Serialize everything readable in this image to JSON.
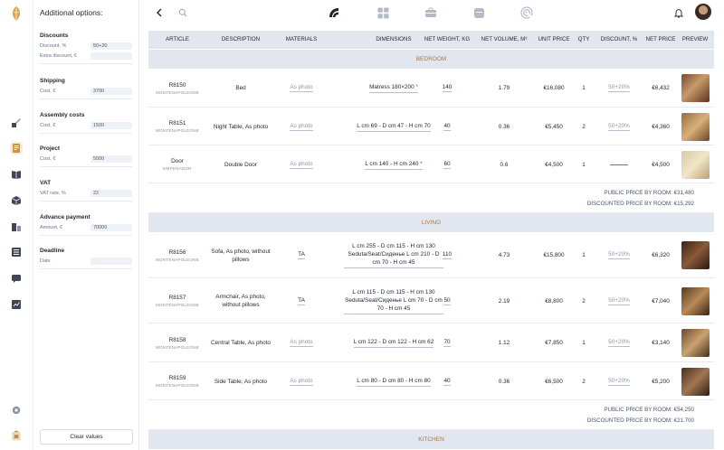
{
  "sidebar": {
    "icons": [
      "brush-icon",
      "document-icon",
      "book-icon",
      "box-icon",
      "building-icon",
      "list-icon",
      "chat-icon",
      "chart-icon",
      "gear-icon",
      "catalog-icon"
    ]
  },
  "options": {
    "title": "Additional options:",
    "sections": [
      {
        "title": "Discounts",
        "rows": [
          {
            "label": "Discount, %",
            "value": "50+20"
          },
          {
            "label": "Extra discount, €",
            "value": ""
          }
        ]
      },
      {
        "title": "Shipping",
        "rows": [
          {
            "label": "Cost, €",
            "value": "3700"
          }
        ]
      },
      {
        "title": "Assembly costs",
        "rows": [
          {
            "label": "Cost, €",
            "value": "1500"
          }
        ]
      },
      {
        "title": "Project",
        "rows": [
          {
            "label": "Cost, €",
            "value": "5000"
          }
        ]
      },
      {
        "title": "VAT",
        "rows": [
          {
            "label": "VAT rate, %",
            "value": "22"
          }
        ]
      },
      {
        "title": "Advance payment",
        "rows": [
          {
            "label": "Amount, €",
            "value": "70000"
          }
        ]
      },
      {
        "title": "Deadline",
        "rows": [
          {
            "label": "Date",
            "value": ""
          }
        ]
      }
    ],
    "clear_label": "Clear values"
  },
  "colors": {
    "accent": "#a6784b",
    "header_bg": "#e1e6ef",
    "required": "#d23b3b"
  },
  "table": {
    "headers": [
      "ARTICLE",
      "DESCRIPTION",
      "MATERIALS",
      "DIMENSIONS",
      "NET WEIGHT, KG",
      "NET VOLUME, M³",
      "UNIT PRICE",
      "QTY",
      "DISCOUNT, %",
      "NET PRICE",
      "PREVIEW"
    ],
    "groups": [
      {
        "name": "BEDROOM",
        "rows": [
          {
            "article": "R8150",
            "brand": "MONTENAPOLEONE",
            "description": "Bed",
            "materials": "As photo",
            "materials_muted": true,
            "dimensions": "Matress 180×200",
            "dim_star": true,
            "weight": "140",
            "volume": "1.79",
            "unit_price": "€16,080",
            "qty": "1",
            "discount": "50+20%",
            "net_price": "€6,432"
          },
          {
            "article": "R8151",
            "brand": "MONTENAPOLEONE",
            "description": "Night Table, As photo",
            "materials": "As photo",
            "materials_muted": true,
            "dimensions": "L cm 69 - D cm 47 - H cm 70",
            "dim_star": false,
            "weight": "40",
            "volume": "0.36",
            "unit_price": "€5,450",
            "qty": "2",
            "discount": "50+20%",
            "net_price": "€4,360"
          },
          {
            "article": "Door",
            "brand": "EMPENADOR",
            "description": "Double Door",
            "materials": "As photo",
            "materials_muted": true,
            "dimensions": "L cm 140 - H cm 240",
            "dim_star": true,
            "weight": "60",
            "volume": "0.6",
            "unit_price": "€4,500",
            "qty": "1",
            "discount": "",
            "net_price": "€4,500"
          }
        ],
        "public_price": "PUBLIC PRICE BY ROOM: €31,480",
        "discounted_price": "DISCOUNTED PRICE BY ROOM: €15,292"
      },
      {
        "name": "LIVING",
        "rows": [
          {
            "article": "R8156",
            "brand": "MONTENAPOLEONE",
            "description": "Sofa, As photo, without pillows",
            "materials": "TA",
            "materials_muted": false,
            "dimensions": "L cm 255 - D cm 115 - H cm 130 Seduta/Seat/Сиденье L cm 210 - D cm 70 - H cm 45",
            "dim_star": false,
            "weight": "110",
            "volume": "4.73",
            "unit_price": "€15,800",
            "qty": "1",
            "discount": "50+20%",
            "net_price": "€6,320"
          },
          {
            "article": "R8157",
            "brand": "MONTENAPOLEONE",
            "description": "Armchair, As photo, without pillows",
            "materials": "TA",
            "materials_muted": false,
            "dimensions": "L cm 115 - D cm 115 - H cm 130 Seduta/Seat/Сиденье L cm 70 - D cm 70 - H cm 45",
            "dim_star": false,
            "weight": "50",
            "volume": "2.19",
            "unit_price": "€8,800",
            "qty": "2",
            "discount": "50+20%",
            "net_price": "€7,040"
          },
          {
            "article": "R8158",
            "brand": "MONTENAPOLEONE",
            "description": "Central Table, As photo",
            "materials": "As photo",
            "materials_muted": true,
            "dimensions": "L cm 122 - D cm 122 - H cm 62",
            "dim_star": false,
            "weight": "70",
            "volume": "1.12",
            "unit_price": "€7,850",
            "qty": "1",
            "discount": "50+20%",
            "net_price": "€3,140"
          },
          {
            "article": "R8159",
            "brand": "MONTENAPOLEONE",
            "description": "Side Table, As photo",
            "materials": "As photo",
            "materials_muted": true,
            "dimensions": "L cm 80 - D cm 80 - H cm 80",
            "dim_star": false,
            "weight": "40",
            "volume": "0.36",
            "unit_price": "€6,500",
            "qty": "2",
            "discount": "50+20%",
            "net_price": "€5,200"
          }
        ],
        "public_price": "PUBLIC PRICE BY ROOM: €54,250",
        "discounted_price": "DISCOUNTED PRICE BY ROOM: €21,700"
      },
      {
        "name": "KITCHEN",
        "rows": []
      }
    ]
  }
}
